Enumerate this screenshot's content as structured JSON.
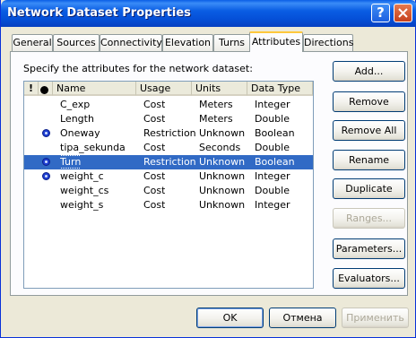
{
  "window": {
    "title": "Network Dataset Properties",
    "help_glyph": "?"
  },
  "tabs": [
    {
      "label": "General",
      "active": false
    },
    {
      "label": "Sources",
      "active": false
    },
    {
      "label": "Connectivity",
      "active": false
    },
    {
      "label": "Elevation",
      "active": false
    },
    {
      "label": "Turns",
      "active": false
    },
    {
      "label": "Attributes",
      "active": true
    },
    {
      "label": "Directions",
      "active": false
    }
  ],
  "panel": {
    "instruction": "Specify the attributes for the network dataset:"
  },
  "list": {
    "columns": [
      "!",
      "",
      "Name",
      "Usage",
      "Units",
      "Data Type"
    ],
    "rows": [
      {
        "flag": false,
        "name": "C_exp",
        "usage": "Cost",
        "units": "Meters",
        "type": "Integer"
      },
      {
        "flag": false,
        "name": "Length",
        "usage": "Cost",
        "units": "Meters",
        "type": "Double"
      },
      {
        "flag": true,
        "name": "Oneway",
        "usage": "Restriction",
        "units": "Unknown",
        "type": "Boolean"
      },
      {
        "flag": false,
        "name": "tipa_sekunda",
        "usage": "Cost",
        "units": "Seconds",
        "type": "Double"
      },
      {
        "flag": true,
        "name": "Turn",
        "usage": "Restriction",
        "units": "Unknown",
        "type": "Boolean",
        "selected": true
      },
      {
        "flag": true,
        "name": "weight_c",
        "usage": "Cost",
        "units": "Unknown",
        "type": "Integer"
      },
      {
        "flag": false,
        "name": "weight_cs",
        "usage": "Cost",
        "units": "Unknown",
        "type": "Double"
      },
      {
        "flag": false,
        "name": "weight_s",
        "usage": "Cost",
        "units": "Unknown",
        "type": "Integer"
      }
    ]
  },
  "side_buttons": {
    "add": "Add...",
    "remove": "Remove",
    "remove_all": "Remove All",
    "rename": "Rename",
    "duplicate": "Duplicate",
    "ranges": "Ranges...",
    "parameters": "Parameters...",
    "evaluators": "Evaluators..."
  },
  "footer": {
    "ok": "OK",
    "cancel": "Отмена",
    "apply": "Применить"
  }
}
